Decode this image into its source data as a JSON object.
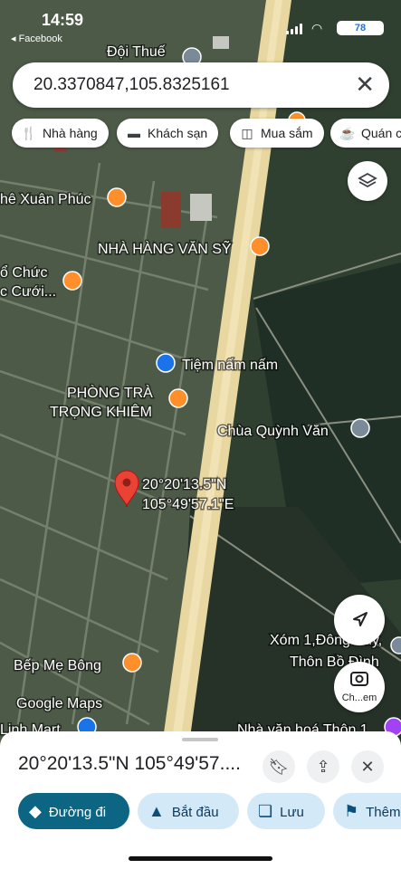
{
  "status_bar": {
    "time": "14:59",
    "back_app": "◂ Facebook",
    "battery": "78"
  },
  "search": {
    "query": "20.3370847,105.8325161"
  },
  "chips": [
    {
      "label": "Nhà hàng",
      "icon": "restaurant-icon"
    },
    {
      "label": "Khách sạn",
      "icon": "hotel-icon"
    },
    {
      "label": "Mua sắm",
      "icon": "shopping-bag-icon"
    },
    {
      "label": "Quán cà",
      "icon": "coffee-icon"
    }
  ],
  "map": {
    "places": {
      "doi_thue": "Đội Thuế",
      "xuan_phuc": "hê Xuân Phúc",
      "nha_hang_van_sy": "NHÀ HÀNG VĂN SỸ",
      "to_chuc_1": "ổ Chức",
      "to_chuc_2": "c Cưới...",
      "tiem_nam": "Tiệm nấm nấm",
      "phong_tra_1": "PHÒNG TRÀ",
      "phong_tra_2": "TRỌNG KHIÊM",
      "chua_quynh_van": "Chùa Quỳnh Văn",
      "xom_1": "Xóm 1,Đông Xuy,",
      "thon_bo_dinh": "Thôn Bồ Đình",
      "bep_me_bong": "Bếp Mẹ Bông",
      "linh_mart": "Linh Mart",
      "nha_van_hoa": "Nhà văn hoá Thôn 1",
      "google_maps": "Google Maps"
    },
    "pin": {
      "lat_label": "20°20'13.5\"N",
      "lng_label": "105°49'57.1\"E"
    }
  },
  "buttons": {
    "lens_label": "Ch...em"
  },
  "sheet": {
    "title": "20°20'13.5\"N 105°49'57....",
    "actions": [
      {
        "label": "Đường đi",
        "icon": "directions-icon"
      },
      {
        "label": "Bắt đầu",
        "icon": "navigation-arrow-icon"
      },
      {
        "label": "Lưu",
        "icon": "bookmark-icon"
      },
      {
        "label": "Thêm",
        "icon": "flag-icon"
      }
    ]
  }
}
